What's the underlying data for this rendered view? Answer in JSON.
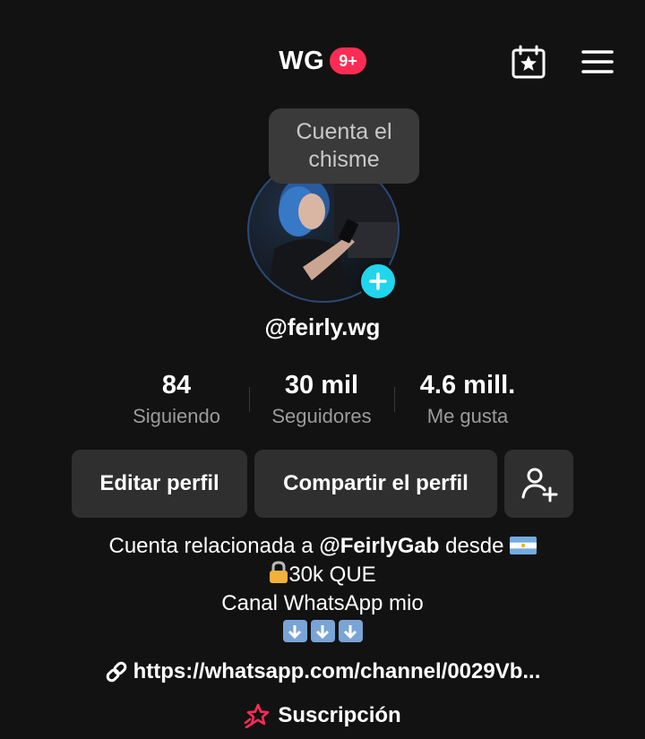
{
  "header": {
    "title": "WG",
    "notification_badge": "9+"
  },
  "tooltip": {
    "text": "Cuenta el chisme"
  },
  "profile": {
    "username": "@feirly.wg"
  },
  "stats": [
    {
      "value": "84",
      "label": "Siguiendo"
    },
    {
      "value": "30 mil",
      "label": "Seguidores"
    },
    {
      "value": "4.6 mill.",
      "label": "Me gusta"
    }
  ],
  "actions": {
    "edit_profile": "Editar perfil",
    "share_profile": "Compartir el perfil"
  },
  "bio": {
    "line1_prefix": "Cuenta relacionada a ",
    "line1_account": "@FeirlyGab",
    "line1_suffix": " desde",
    "line2": "30k QUE",
    "line3": "Canal WhatsApp mio"
  },
  "link": {
    "url": "https://whatsapp.com/channel/0029Vb..."
  },
  "subscription": {
    "label": "Suscripción"
  },
  "colors": {
    "background": "#121212",
    "badge": "#fe2c55",
    "add_button": "#20d5ec",
    "button_bg": "#2f2f2f",
    "subscription_icon": "#fe2c55"
  },
  "icons": {
    "calendar": "calendar-star-icon",
    "menu": "hamburger-menu-icon",
    "add_avatar": "plus-icon",
    "add_friend": "add-user-icon",
    "lock": "lock-icon",
    "flag": "argentina-flag-icon",
    "arrows": "down-arrow-icon",
    "link": "link-icon",
    "subscription": "star-sparkle-icon"
  }
}
